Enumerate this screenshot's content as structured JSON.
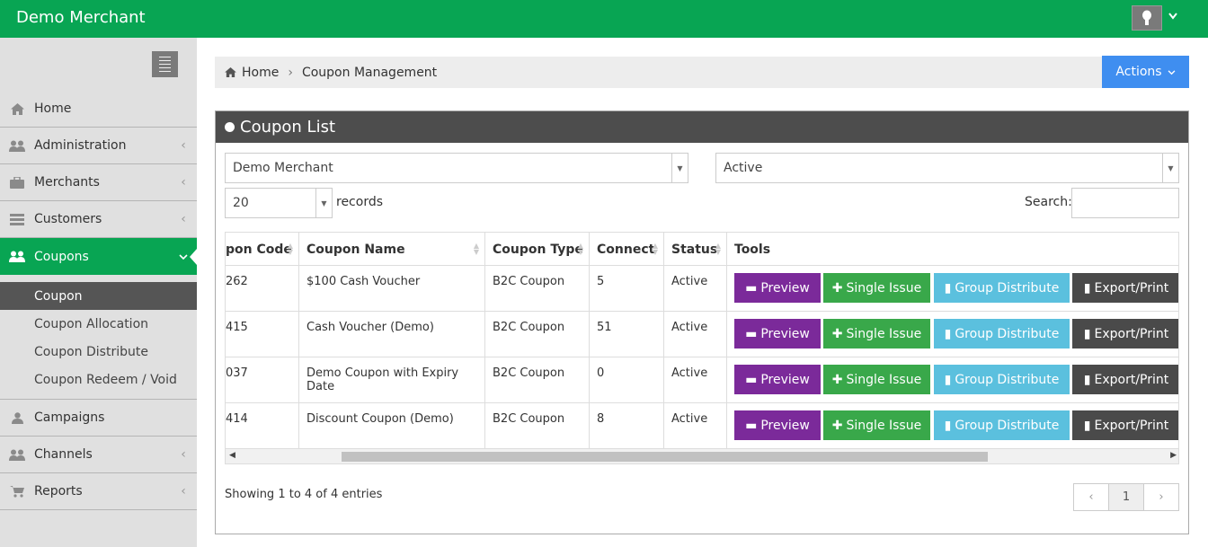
{
  "header": {
    "brand": "Demo Merchant"
  },
  "sidebar": {
    "items": [
      {
        "label": "Home",
        "icon": "home-icon"
      },
      {
        "label": "Administration",
        "icon": "users-icon"
      },
      {
        "label": "Merchants",
        "icon": "briefcase-icon"
      },
      {
        "label": "Customers",
        "icon": "list-icon"
      },
      {
        "label": "Coupons",
        "icon": "users-icon"
      },
      {
        "label": "Campaigns",
        "icon": "user-icon"
      },
      {
        "label": "Channels",
        "icon": "users-icon"
      },
      {
        "label": "Reports",
        "icon": "cart-icon"
      }
    ],
    "sub_items": [
      "Coupon",
      "Coupon Allocation",
      "Coupon Distribute",
      "Coupon Redeem / Void"
    ]
  },
  "breadcrumb": {
    "home": "Home",
    "current": "Coupon Management"
  },
  "actions_label": "Actions",
  "panel_title": "Coupon List",
  "filters": {
    "merchant": "Demo Merchant",
    "status": "Active",
    "page_length": "20",
    "records_label": "records",
    "search_label": "Search:"
  },
  "table": {
    "headers": [
      "pon Code",
      "Coupon Name",
      "Coupon Type",
      "Connect",
      "Status",
      "Tools"
    ],
    "rows": [
      {
        "code": "262",
        "name": "$100 Cash Voucher",
        "type": "B2C Coupon",
        "connect": "5",
        "status": "Active"
      },
      {
        "code": "415",
        "name": "Cash Voucher (Demo)",
        "type": "B2C Coupon",
        "connect": "51",
        "status": "Active"
      },
      {
        "code": "037",
        "name": "Demo Coupon with Expiry Date",
        "type": "B2C Coupon",
        "connect": "0",
        "status": "Active"
      },
      {
        "code": "414",
        "name": "Discount Coupon (Demo)",
        "type": "B2C Coupon",
        "connect": "8",
        "status": "Active"
      }
    ],
    "tools": {
      "preview": "Preview",
      "single": "Single Issue",
      "group": "Group Distribute",
      "export": "Export/Print"
    }
  },
  "footer": {
    "info": "Showing 1 to 4 of 4 entries",
    "prev": "‹",
    "page": "1",
    "next": "›"
  },
  "colors": {
    "brand_green": "#08a553",
    "actions_blue": "#3f8ef0",
    "preview_purple": "#7b2a9a",
    "single_green": "#39a84a",
    "group_blue": "#5bc0de",
    "export_dark": "#4a4a4a"
  }
}
